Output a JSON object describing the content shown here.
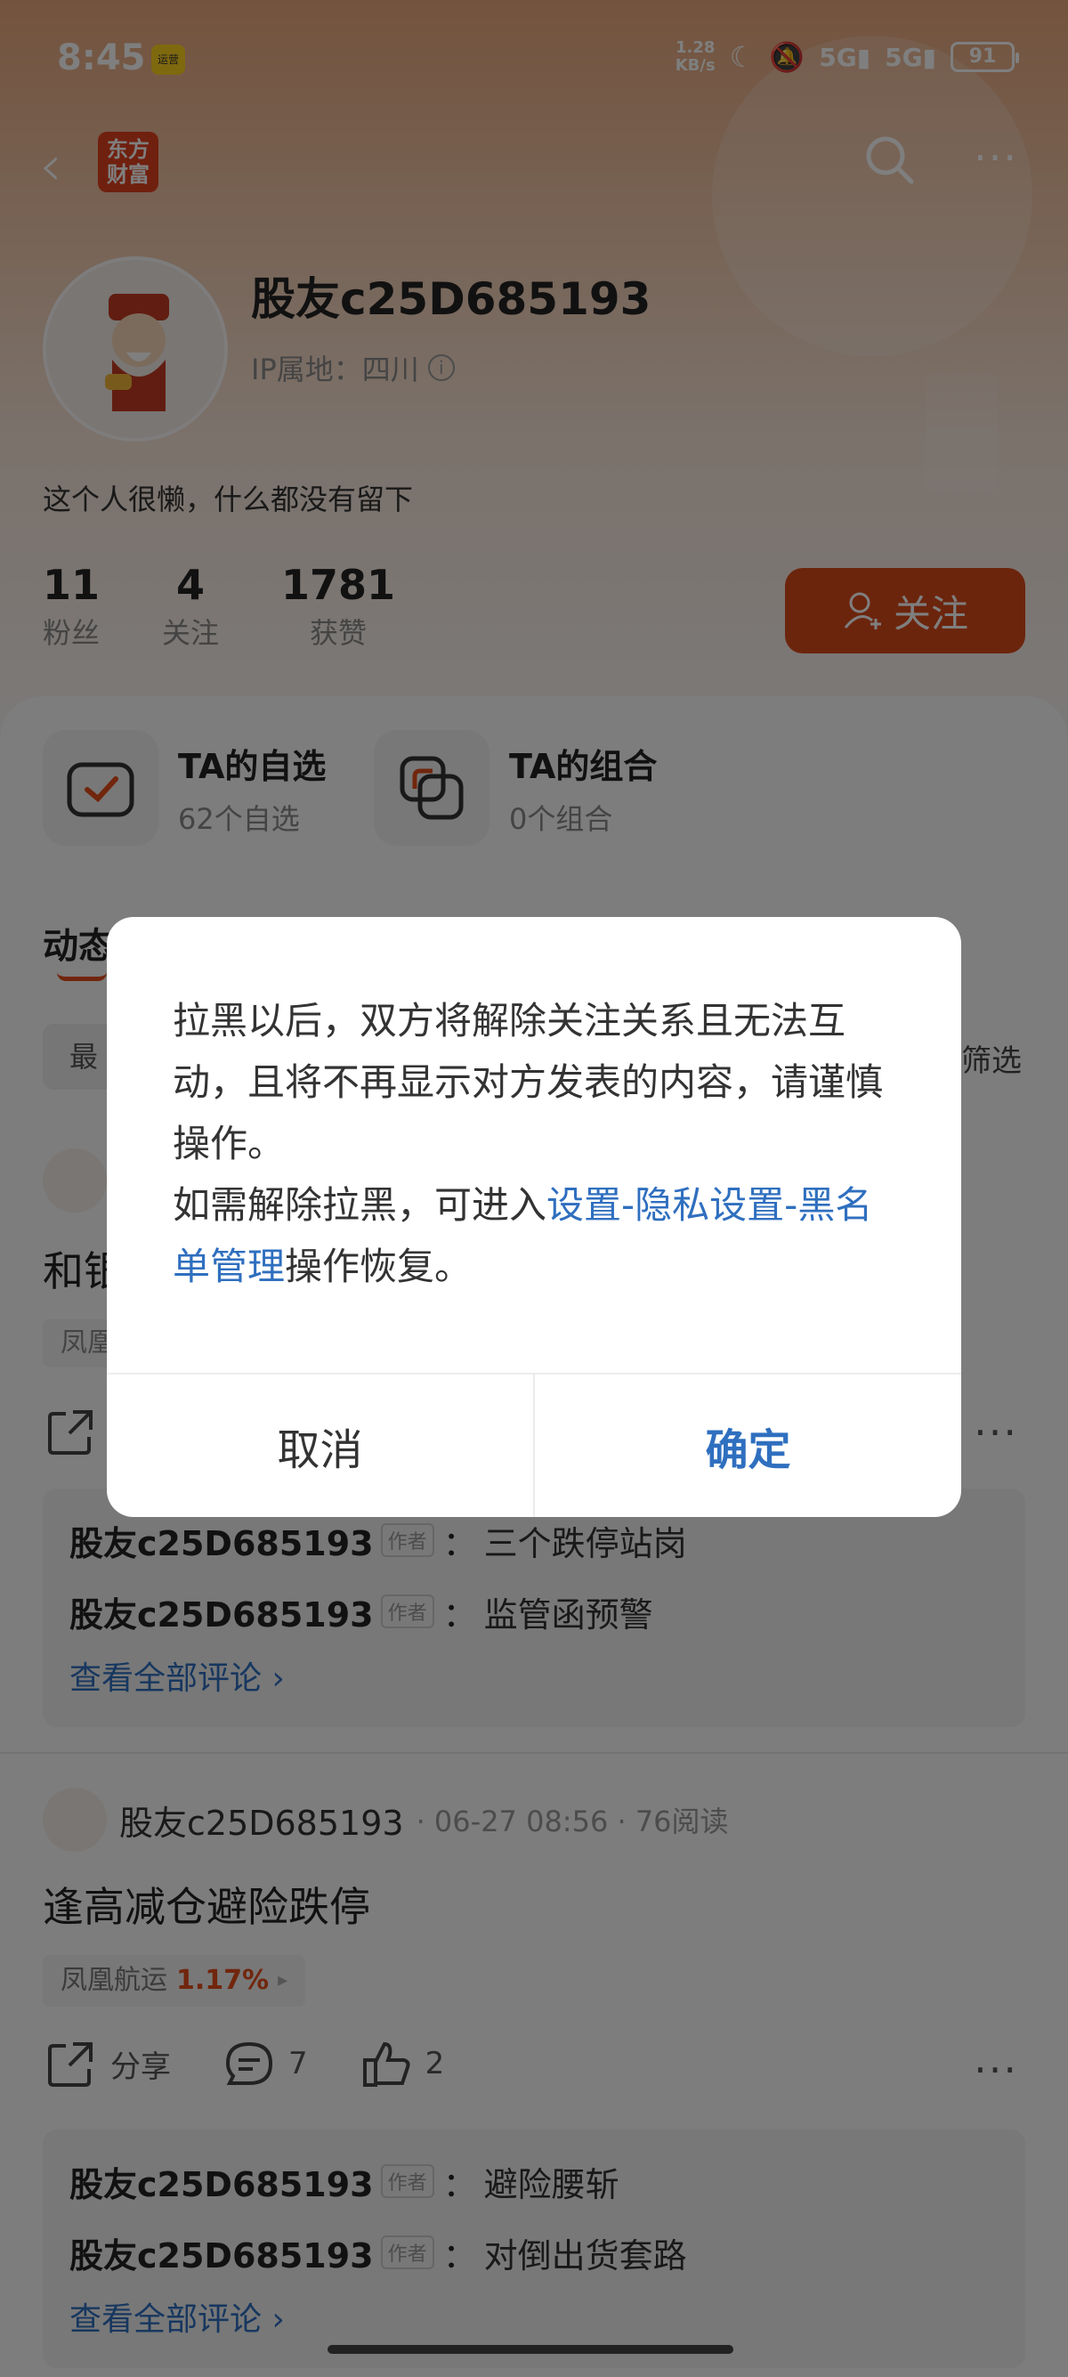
{
  "status_bar": {
    "time": "8:45",
    "badge": "运营",
    "speed_value": "1.28",
    "speed_unit": "KB/s",
    "signal1": "5G",
    "signal2": "5G",
    "battery": "91"
  },
  "nav": {
    "brand": "东方财富",
    "more_label": "···"
  },
  "profile": {
    "username": "股友c25D685193",
    "ip_label": "IP属地：四川",
    "bio": "这个人很懒，什么都没有留下",
    "stats": [
      {
        "num": "11",
        "label": "粉丝"
      },
      {
        "num": "4",
        "label": "关注"
      },
      {
        "num": "1781",
        "label": "获赞"
      }
    ],
    "follow_label": "关注"
  },
  "portfolio": {
    "watchlist_title": "TA的自选",
    "watchlist_sub": "62个自选",
    "combo_title": "TA的组合",
    "combo_sub": "0个组合"
  },
  "feed": {
    "section_title": "动态",
    "filter_left": "最",
    "filter_right": "筛选",
    "post1": {
      "title_partial": "和银",
      "stock_partial": "凤凰",
      "comments": [
        {
          "name": "股友c25D685193",
          "tag": "作者",
          "text": "三个跌停站岗"
        },
        {
          "name": "股友c25D685193",
          "tag": "作者",
          "text": "监管函预警"
        }
      ],
      "see_all": "查看全部评论 ›"
    },
    "post2": {
      "author": "股友c25D685193",
      "meta": "· 06-27 08:56 · 76阅读",
      "title": "逢高减仓避险跌停",
      "stock_name": "凤凰航运",
      "stock_pct": "1.17%",
      "stock_arrow": "▸",
      "share_label": "分享",
      "comment_count": "7",
      "like_count": "2",
      "comments": [
        {
          "name": "股友c25D685193",
          "tag": "作者",
          "text": "避险腰斩"
        },
        {
          "name": "股友c25D685193",
          "tag": "作者",
          "text": "对倒出货套路"
        }
      ],
      "see_all": "查看全部评论 ›"
    }
  },
  "dialog": {
    "text_part1": "拉黑以后，双方将解除关注关系且无法互动，且将不再显示对方发表的内容，请谨慎操作。",
    "text_part2_prefix": "如需解除拉黑，可进入",
    "text_link": "设置-隐私设置-黑名单管理",
    "text_part2_suffix": "操作恢复。",
    "cancel_label": "取消",
    "confirm_label": "确定"
  },
  "colors": {
    "accent": "#d84a1a",
    "link": "#2f6fbf",
    "stock_up": "#e24d1a"
  }
}
